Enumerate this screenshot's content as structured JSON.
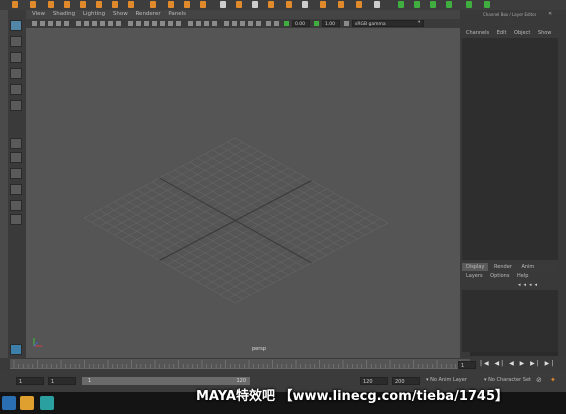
{
  "window": {
    "right_panel_title": "Channel Box / Layer Editor"
  },
  "panel_menu": [
    "View",
    "Shading",
    "Lighting",
    "Show",
    "Renderer",
    "Panels"
  ],
  "view_toolbar": {
    "field_a": "0.00",
    "field_b": "1.00",
    "color_space": "sRGB gamma"
  },
  "viewport": {
    "camera_label": "persp"
  },
  "channel_box": {
    "menu": [
      "Channels",
      "Edit",
      "Object",
      "Show"
    ]
  },
  "layer_editor": {
    "tabs": [
      "Display",
      "Render",
      "Anim"
    ],
    "active_tab": "Display",
    "menu": [
      "Layers",
      "Options",
      "Help"
    ]
  },
  "range": {
    "start_field": "1",
    "current_field": "1",
    "slider_start": "1",
    "slider_end": "120",
    "end_field": "120",
    "max_field": "200",
    "anim_layer": "No Anim Layer",
    "character_set": "No Character Set",
    "current_frame": "1"
  },
  "banner": {
    "text": "MAYA特效吧 【www.linecg.com/tieba/1745】"
  },
  "colors": {
    "selected_tool": "#5285a6",
    "shelf_orange": "#e08a2c",
    "shelf_green": "#3fae3f",
    "viewport_bg": "#555555",
    "grid_line": "#6a6a6a",
    "grid_axis": "#3a3a3a"
  }
}
